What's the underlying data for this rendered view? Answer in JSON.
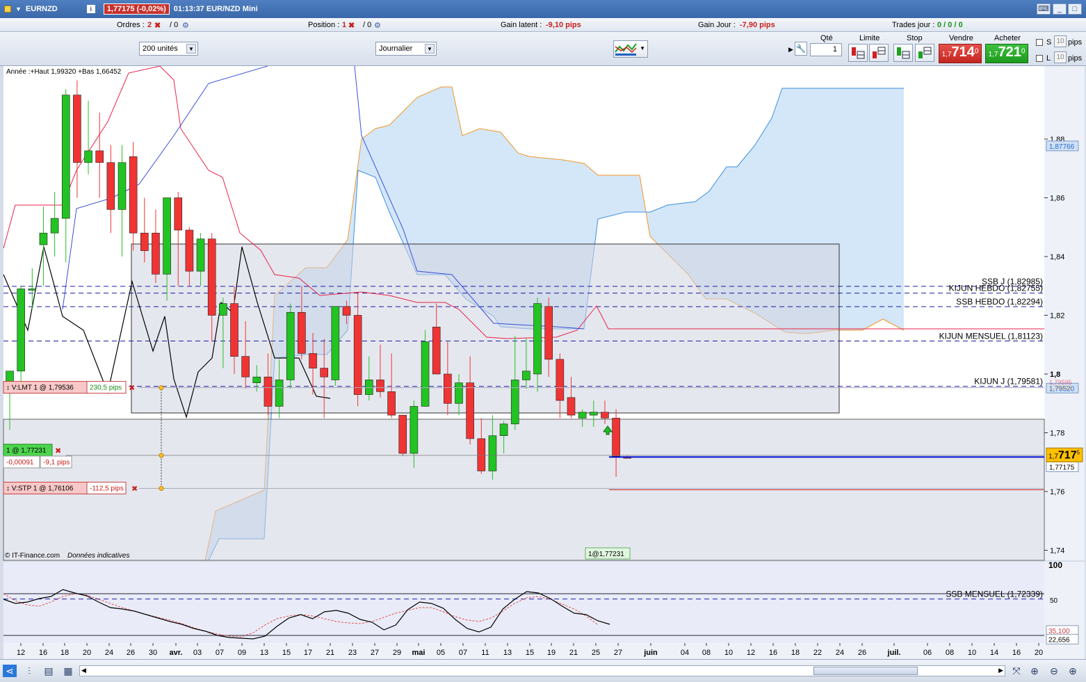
{
  "window": {
    "symbol": "EURNZD",
    "price_badge": "1,77175 (-0,02%)",
    "time_title": "01:13:37 EUR/NZD Mini"
  },
  "infobar": {
    "ordres_label": "Ordres :",
    "ordres_count": "2",
    "ordres_sep": "/ 0",
    "position_label": "Position :",
    "position_count": "1",
    "position_sep": "/ 0",
    "gain_latent_label": "Gain latent :",
    "gain_latent_value": "-9,10 pips",
    "gain_jour_label": "Gain Jour :",
    "gain_jour_value": "-7,90 pips",
    "trades_label": "Trades jour :",
    "trades_value": "0 / 0 / 0"
  },
  "toolbar": {
    "units_select": "200 unités",
    "period_select": "Journalier",
    "qte_label": "Qté",
    "qte_value": "1",
    "limite_label": "Limite",
    "stop_label": "Stop",
    "vendre_label": "Vendre",
    "acheter_label": "Acheter",
    "sell_prefix": "1,7",
    "sell_big": "714",
    "sell_sup": "0",
    "buy_prefix": "1,7",
    "buy_big": "721",
    "buy_sup": "0",
    "s_label": "S",
    "l_label": "L",
    "pips_value": "10",
    "pips_label": "pips"
  },
  "chart_labels": {
    "year_info": "Année :+Haut 1,99320 +Bas 1,66452",
    "copyright": "© IT-Finance.com",
    "indicative": "Données indicatives",
    "position_tag": "1@1,77231",
    "ssb_j": "SSB J (1,82985)",
    "kijun_hebdo": "KIJUN HEBDO (1,82755)",
    "ssb_hebdo": "SSB HEBDO (1,82294)",
    "kijun_mensuel": "KIJUN MENSUEL (1,81123)",
    "kijun_j": "KIJUN J (1,79581)",
    "ssb_mensuel": "SSB MENSUEL (1,72339)",
    "lmt_order": "V:LMT  1 @ 1,79536",
    "lmt_pips": "230,5 pips",
    "stp_order": "V:STP  1 @ 1,76106",
    "stp_pips": "-112,5 pips",
    "pos_order": "1 @ 1,77231",
    "pos_pnl": "-0,00091",
    "pos_pips": "-9,1 pips"
  },
  "y_axis": {
    "ticks": [
      "1,88",
      "1,86",
      "1,84",
      "1,82",
      "1,8",
      "1,78",
      "1,76",
      "1,74"
    ],
    "tags": [
      "1,87766",
      "1,79520",
      "1,77175"
    ],
    "current_prefix": "1,7",
    "current_big": "717",
    "current_sup": "5",
    "faint_tags": [
      "1,79595",
      "1,79543"
    ]
  },
  "osc_axis": {
    "ticks": [
      "100",
      "50"
    ],
    "tags": [
      "35,100",
      "22,656"
    ]
  },
  "x_axis": {
    "labels": [
      "12",
      "16",
      "18",
      "20",
      "24",
      "26",
      "30",
      "avr.",
      "03",
      "07",
      "09",
      "13",
      "15",
      "17",
      "21",
      "23",
      "27",
      "29",
      "mai",
      "05",
      "07",
      "11",
      "13",
      "15",
      "19",
      "21",
      "25",
      "27",
      "juin",
      "04",
      "08",
      "10",
      "12",
      "16",
      "18",
      "22",
      "24",
      "26",
      "juil.",
      "06",
      "08",
      "10",
      "14",
      "16",
      "20"
    ],
    "bold": [
      "avr.",
      "mai",
      "juin",
      "juil."
    ]
  },
  "colors": {
    "up": "#22c322",
    "down": "#f03434",
    "tenkan": "#e8224a",
    "kijun": "#3a4fd8",
    "ssa": "#f3962a",
    "ssb": "#3b8fe0",
    "cloud": "#cde3f7",
    "chikou": "#000000",
    "hline": "#1a1aa8"
  },
  "chart_data": {
    "type": "candlestick",
    "title": "EUR/NZD Mini — Journalier",
    "ylim": [
      1.7,
      1.885
    ],
    "candles": [
      {
        "o": 1.796,
        "h": 1.801,
        "l": 1.781,
        "c": 1.801
      },
      {
        "o": 1.801,
        "h": 1.83,
        "l": 1.795,
        "c": 1.829
      },
      {
        "o": 1.829,
        "h": 1.836,
        "l": 1.822,
        "c": 1.829
      },
      {
        "o": 1.844,
        "h": 1.857,
        "l": 1.83,
        "c": 1.848
      },
      {
        "o": 1.848,
        "h": 1.862,
        "l": 1.84,
        "c": 1.853
      },
      {
        "o": 1.853,
        "h": 1.897,
        "l": 1.838,
        "c": 1.895
      },
      {
        "o": 1.895,
        "h": 1.9,
        "l": 1.86,
        "c": 1.872
      },
      {
        "o": 1.872,
        "h": 1.893,
        "l": 1.868,
        "c": 1.876
      },
      {
        "o": 1.876,
        "h": 1.889,
        "l": 1.86,
        "c": 1.872
      },
      {
        "o": 1.872,
        "h": 1.878,
        "l": 1.848,
        "c": 1.856
      },
      {
        "o": 1.856,
        "h": 1.878,
        "l": 1.84,
        "c": 1.872
      },
      {
        "o": 1.874,
        "h": 1.879,
        "l": 1.842,
        "c": 1.848
      },
      {
        "o": 1.848,
        "h": 1.86,
        "l": 1.838,
        "c": 1.842
      },
      {
        "o": 1.848,
        "h": 1.856,
        "l": 1.831,
        "c": 1.834
      },
      {
        "o": 1.834,
        "h": 1.86,
        "l": 1.825,
        "c": 1.86
      },
      {
        "o": 1.86,
        "h": 1.862,
        "l": 1.83,
        "c": 1.849
      },
      {
        "o": 1.849,
        "h": 1.85,
        "l": 1.83,
        "c": 1.835
      },
      {
        "o": 1.835,
        "h": 1.848,
        "l": 1.83,
        "c": 1.846
      },
      {
        "o": 1.846,
        "h": 1.848,
        "l": 1.811,
        "c": 1.82
      },
      {
        "o": 1.82,
        "h": 1.826,
        "l": 1.802,
        "c": 1.824
      },
      {
        "o": 1.824,
        "h": 1.83,
        "l": 1.8,
        "c": 1.806
      },
      {
        "o": 1.806,
        "h": 1.818,
        "l": 1.795,
        "c": 1.799
      },
      {
        "o": 1.797,
        "h": 1.803,
        "l": 1.794,
        "c": 1.799
      },
      {
        "o": 1.799,
        "h": 1.807,
        "l": 1.786,
        "c": 1.789
      },
      {
        "o": 1.789,
        "h": 1.805,
        "l": 1.785,
        "c": 1.798
      },
      {
        "o": 1.798,
        "h": 1.824,
        "l": 1.795,
        "c": 1.821
      },
      {
        "o": 1.821,
        "h": 1.83,
        "l": 1.805,
        "c": 1.807
      },
      {
        "o": 1.807,
        "h": 1.814,
        "l": 1.793,
        "c": 1.802
      },
      {
        "o": 1.802,
        "h": 1.812,
        "l": 1.785,
        "c": 1.799
      },
      {
        "o": 1.798,
        "h": 1.823,
        "l": 1.796,
        "c": 1.823
      },
      {
        "o": 1.823,
        "h": 1.825,
        "l": 1.817,
        "c": 1.82
      },
      {
        "o": 1.82,
        "h": 1.828,
        "l": 1.789,
        "c": 1.793
      },
      {
        "o": 1.793,
        "h": 1.806,
        "l": 1.791,
        "c": 1.798
      },
      {
        "o": 1.798,
        "h": 1.81,
        "l": 1.792,
        "c": 1.794
      },
      {
        "o": 1.794,
        "h": 1.807,
        "l": 1.785,
        "c": 1.786
      },
      {
        "o": 1.786,
        "h": 1.786,
        "l": 1.772,
        "c": 1.773
      },
      {
        "o": 1.773,
        "h": 1.791,
        "l": 1.768,
        "c": 1.789
      },
      {
        "o": 1.789,
        "h": 1.815,
        "l": 1.789,
        "c": 1.811
      },
      {
        "o": 1.816,
        "h": 1.824,
        "l": 1.8,
        "c": 1.8
      },
      {
        "o": 1.8,
        "h": 1.811,
        "l": 1.786,
        "c": 1.79
      },
      {
        "o": 1.79,
        "h": 1.8,
        "l": 1.786,
        "c": 1.797
      },
      {
        "o": 1.797,
        "h": 1.806,
        "l": 1.776,
        "c": 1.778
      },
      {
        "o": 1.778,
        "h": 1.785,
        "l": 1.766,
        "c": 1.767
      },
      {
        "o": 1.767,
        "h": 1.786,
        "l": 1.764,
        "c": 1.779
      },
      {
        "o": 1.779,
        "h": 1.784,
        "l": 1.773,
        "c": 1.783
      },
      {
        "o": 1.783,
        "h": 1.813,
        "l": 1.781,
        "c": 1.798
      },
      {
        "o": 1.798,
        "h": 1.812,
        "l": 1.795,
        "c": 1.801
      },
      {
        "o": 1.8,
        "h": 1.826,
        "l": 1.794,
        "c": 1.824
      },
      {
        "o": 1.823,
        "h": 1.826,
        "l": 1.799,
        "c": 1.805
      },
      {
        "o": 1.805,
        "h": 1.807,
        "l": 1.785,
        "c": 1.791
      },
      {
        "o": 1.792,
        "h": 1.799,
        "l": 1.785,
        "c": 1.786
      },
      {
        "o": 1.785,
        "h": 1.788,
        "l": 1.782,
        "c": 1.787
      },
      {
        "o": 1.786,
        "h": 1.791,
        "l": 1.782,
        "c": 1.787
      },
      {
        "o": 1.787,
        "h": 1.791,
        "l": 1.783,
        "c": 1.785
      },
      {
        "o": 1.785,
        "h": 1.788,
        "l": 1.765,
        "c": 1.772
      },
      {
        "o": 1.7718,
        "h": 1.7722,
        "l": 1.7712,
        "c": 1.7717
      }
    ],
    "horizontal_levels": [
      {
        "name": "SSB J",
        "value": 1.82985
      },
      {
        "name": "KIJUN HEBDO",
        "value": 1.82755
      },
      {
        "name": "SSB HEBDO",
        "value": 1.82294
      },
      {
        "name": "KIJUN MENSUEL",
        "value": 1.81123
      },
      {
        "name": "KIJUN J",
        "value": 1.79581
      },
      {
        "name": "SSB MENSUEL",
        "value": 1.72339
      }
    ],
    "orders": [
      {
        "type": "V:LMT",
        "qty": 1,
        "price": 1.79536,
        "pips": 230.5
      },
      {
        "type": "V:STP",
        "qty": 1,
        "price": 1.76106,
        "pips": -112.5
      },
      {
        "type": "position",
        "qty": 1,
        "price": 1.77231,
        "pnl": -0.00091,
        "pips": -9.1
      }
    ],
    "current_price": 1.77175,
    "oscillator": {
      "ylim": [
        0,
        100
      ],
      "levels": [
        80,
        20
      ],
      "values": [
        72,
        66,
        68,
        73,
        76,
        86,
        81,
        77,
        68,
        60,
        58,
        55,
        50,
        45,
        40,
        36,
        30,
        26,
        20,
        17,
        16,
        15,
        19,
        33,
        45,
        50,
        44,
        54,
        56,
        52,
        43,
        39,
        28,
        35,
        57,
        68,
        66,
        59,
        43,
        30,
        25,
        32,
        58,
        72,
        83,
        81,
        73,
        62,
        52,
        50,
        41,
        36
      ],
      "signal_values": [
        80,
        70,
        64,
        62,
        68,
        76,
        80,
        78,
        72,
        66,
        60,
        55,
        50,
        46,
        42,
        37,
        31,
        26,
        22,
        19,
        18,
        24,
        35,
        44,
        48,
        50,
        48,
        44,
        40,
        38,
        37,
        40,
        46,
        52,
        56,
        60,
        60,
        54,
        47,
        42,
        40,
        45,
        55,
        66,
        74,
        76,
        72,
        65,
        58,
        48,
        35
      ],
      "tags": [
        35.1,
        22.656
      ]
    }
  }
}
